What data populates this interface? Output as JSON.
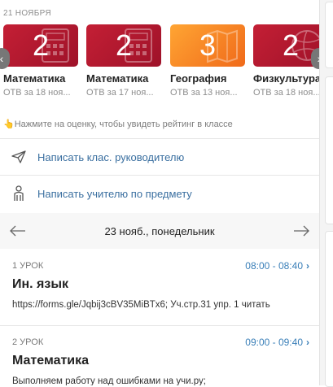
{
  "date_label": "21 НОЯБРЯ",
  "grades": [
    {
      "grade": "2",
      "subject": "Математика",
      "meta": "ОТВ за 18 ноя...",
      "color": "#b8182f"
    },
    {
      "grade": "2",
      "subject": "Математика",
      "meta": "ОТВ за 17 ноя...",
      "color": "#b8182f"
    },
    {
      "grade": "3",
      "subject": "География",
      "meta": "ОТВ за 13 ноя...",
      "color": "#f7851f"
    },
    {
      "grade": "2",
      "subject": "Физкультура",
      "meta": "ОТВ за 18 ноя...",
      "color": "#b8182f"
    }
  ],
  "hint": "👆Нажмите на оценку, чтобы увидеть рейтинг в классе",
  "actions": {
    "write_class_teacher": "Написать клас. руководителю",
    "write_subject_teacher": "Написать учителю по предмету"
  },
  "day_nav": {
    "label": "23 нояб., понедельник"
  },
  "lessons": [
    {
      "number": "1 УРОК",
      "time": "08:00 - 08:40",
      "name": "Ин. язык",
      "description": "https://forms.gle/Jqbij3cBV35MiBTx6; Уч.стр.31 упр. 1 читать"
    },
    {
      "number": "2 УРОК",
      "time": "09:00 - 09:40",
      "name": "Математика",
      "description": "Выполняем работу над ошибками на учи.ру;"
    }
  ]
}
